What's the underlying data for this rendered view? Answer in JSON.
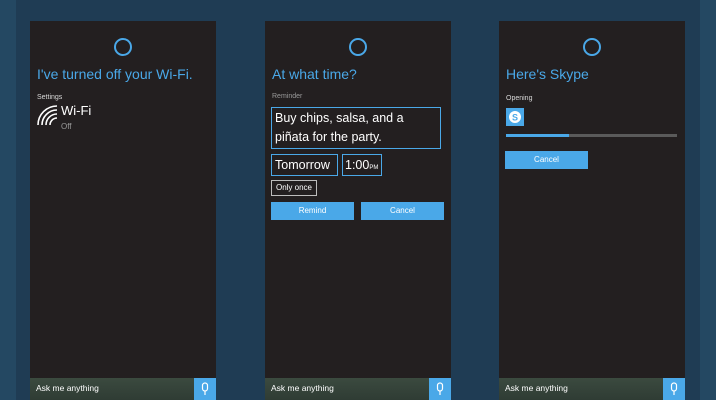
{
  "colors": {
    "background": "#1f3c54",
    "panel": "#231f20",
    "accent": "#4aa8e8",
    "text": "#ffffff",
    "muted": "#9a9a9a"
  },
  "screens": [
    {
      "heading": "I've turned off your Wi-Fi.",
      "label": "Settings",
      "setting": {
        "name": "Wi-Fi",
        "status": "Off",
        "icon": "wifi-icon"
      }
    },
    {
      "heading": "At what time?",
      "label": "Reminder",
      "reminder_text": "Buy chips, salsa, and a piñata for the party.",
      "date": "Tomorrow",
      "time": "1:00",
      "ampm": "PM",
      "repeat": "Only once",
      "buttons": {
        "remind": "Remind",
        "cancel": "Cancel"
      }
    },
    {
      "heading": "Here's Skype",
      "label": "Opening",
      "app_icon": "skype-icon",
      "progress": 0.37,
      "buttons": {
        "cancel": "Cancel"
      }
    }
  ],
  "search_bar": {
    "placeholder": "Ask me anything",
    "mic_icon": "microphone-icon"
  }
}
